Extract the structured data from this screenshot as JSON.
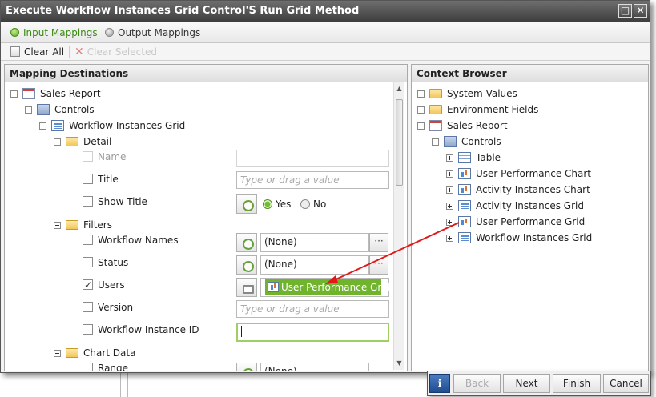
{
  "window": {
    "title": "Execute Workflow Instances Grid Control'S Run Grid Method"
  },
  "tabs": {
    "input": "Input Mappings",
    "output": "Output Mappings"
  },
  "toolbar": {
    "clear_all": "Clear All",
    "clear_selected": "Clear Selected"
  },
  "left": {
    "header": "Mapping Destinations",
    "root": "Sales Report",
    "controls": "Controls",
    "grid": "Workflow Instances Grid",
    "detail": {
      "label": "Detail",
      "name": "Name",
      "title": "Title",
      "title_placeholder": "Type or drag a value",
      "show_title": "Show Title",
      "yes": "Yes",
      "no": "No",
      "show_title_value": "Yes"
    },
    "filters": {
      "label": "Filters",
      "workflow_names": "Workflow Names",
      "workflow_names_value": "(None)",
      "status": "Status",
      "status_value": "(None)",
      "users": "Users",
      "users_checked": true,
      "users_value": "User Performance Grid",
      "version": "Version",
      "version_placeholder": "Type or drag a value",
      "instance_id": "Workflow Instance ID"
    },
    "chart_data": {
      "label": "Chart Data",
      "range": "Range",
      "range_value": "(None)"
    },
    "dots": "···"
  },
  "right": {
    "header": "Context Browser",
    "items": [
      "System Values",
      "Environment Fields",
      "Sales Report",
      "Controls",
      "Table",
      "User Performance Chart",
      "Activity Instances Chart",
      "Activity Instances Grid",
      "User Performance Grid",
      "Workflow Instances Grid"
    ]
  },
  "footer": {
    "info": "i",
    "back": "Back",
    "next": "Next",
    "finish": "Finish",
    "cancel": "Cancel"
  },
  "colors": {
    "accent_green": "#6fb42c",
    "arrow_red": "#e01a1a",
    "titlebar": "#4a4a4a"
  }
}
